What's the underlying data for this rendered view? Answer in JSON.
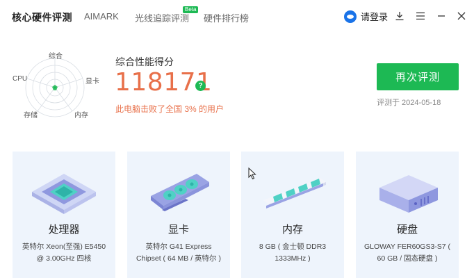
{
  "header": {
    "app_title": "核心硬件评测",
    "nav": [
      {
        "label": "AIMARK"
      },
      {
        "label": "光线追踪评测",
        "badge": "Beta"
      },
      {
        "label": "硬件排行榜"
      }
    ],
    "login_label": "请登录"
  },
  "radar": {
    "labels": {
      "overall": "综合",
      "gpu": "显卡",
      "memory": "内存",
      "storage": "存储",
      "cpu": "CPU"
    }
  },
  "score": {
    "caption": "综合性能得分",
    "value": "118171",
    "help": "?",
    "beat_text": "此电脑击败了全国 3% 的用户"
  },
  "actions": {
    "retest_label": "再次评测",
    "test_date": "评测于 2024-05-18"
  },
  "cards": [
    {
      "title": "处理器",
      "desc": "英特尔 Xeon(至强) E5450 @ 3.00GHz 四核"
    },
    {
      "title": "显卡",
      "desc": "英特尔 G41 Express Chipset ( 64 MB / 英特尔 )"
    },
    {
      "title": "内存",
      "desc": "8 GB ( 金士顿 DDR3 1333MHz )"
    },
    {
      "title": "硬盘",
      "desc": "GLOWAY FER60GS3-S7 ( 60 GB / 固态硬盘 )"
    }
  ],
  "colors": {
    "accent_green": "#1db954",
    "score_orange": "#e8704a",
    "card_bg": "#eef4fc"
  },
  "icons": [
    "user-avatar-icon",
    "download-icon",
    "menu-icon",
    "minimize-icon",
    "close-icon",
    "help-icon",
    "mouse-cursor-icon"
  ]
}
